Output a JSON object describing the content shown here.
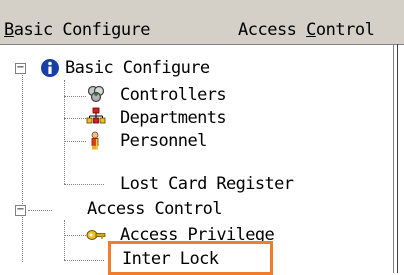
{
  "menubar": {
    "basic_configure": {
      "accel": "B",
      "rest": "asic Configure"
    },
    "access_control": {
      "prefix": "Access ",
      "accel": "C",
      "rest": "ontrol"
    }
  },
  "tree": {
    "basic_configure": {
      "label": "Basic Configure",
      "expander": "−",
      "icon": "info-icon"
    },
    "controllers": {
      "label": "Controllers",
      "icon": "controllers-icon"
    },
    "departments": {
      "label": "Departments",
      "icon": "departments-icon"
    },
    "personnel": {
      "label": "Personnel",
      "icon": "personnel-icon"
    },
    "lost_card": {
      "label": "Lost Card Register"
    },
    "access_control": {
      "label": "Access Control",
      "expander": "−"
    },
    "access_privilege": {
      "label": "Access Privilege",
      "icon": "key-icon"
    },
    "inter_lock": {
      "label": "Inter Lock"
    }
  },
  "colors": {
    "highlight": "#f07c2c",
    "menubar_bg": "#d4d0c8"
  }
}
